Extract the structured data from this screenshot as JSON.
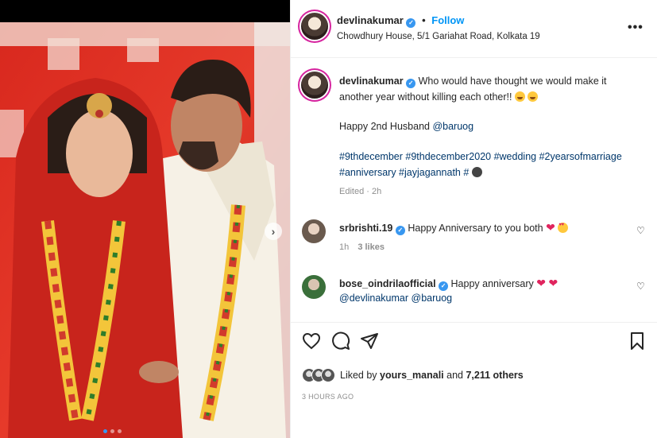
{
  "header": {
    "username": "devlinakumar",
    "follow_label": "Follow",
    "dot": "•",
    "location": "Chowdhury House, 5/1 Gariahat Road, Kolkata 19",
    "more_label": "•••"
  },
  "caption": {
    "username": "devlinakumar",
    "line1": "Who would have thought we would make it",
    "line2": "another year without killing each other!!",
    "line3": "Happy 2nd Husband",
    "mention": "@baruog",
    "hashtags_line1": "#9thdecember #9thdecember2020 #wedding #2yearsofmarriage",
    "hashtags_line2": "#anniversary #jayjagannath #",
    "edited": "Edited · 2h"
  },
  "comments": [
    {
      "username": "srbrishti.19",
      "text": "Happy Anniversary to you both",
      "time": "1h",
      "likes": "3 likes"
    },
    {
      "username": "bose_oindrilaofficial",
      "text": "Happy anniversary",
      "line2": "@devlinakumar @baruog"
    }
  ],
  "likes": {
    "prefix": "Liked by",
    "user": "yours_manali",
    "and": "and",
    "count": "7,211 others"
  },
  "posted": "3 HOURS AGO",
  "icons": {
    "verified": "verified-badge-icon",
    "heart": "heart-icon",
    "comment": "comment-icon",
    "share": "share-icon",
    "save": "bookmark-icon",
    "next": "chevron-right-icon"
  },
  "colors": {
    "link": "#00376b",
    "follow": "#0095f6",
    "verified": "#3897f0",
    "muted": "#8e8e8e",
    "heart_red": "#e0245e"
  }
}
